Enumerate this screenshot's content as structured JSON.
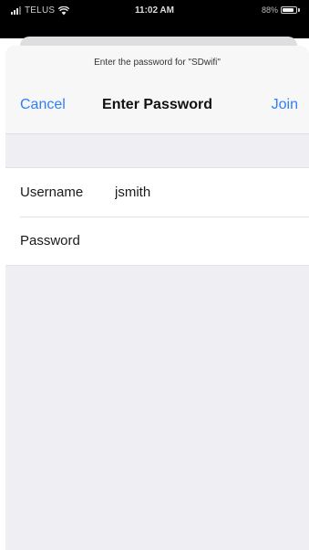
{
  "status_bar": {
    "carrier": "TELUS",
    "time": "11:02 AM",
    "battery_text": "88%",
    "battery_level": 0.88,
    "signal_icon": "cellular-signal-icon",
    "wifi_icon": "wifi-icon",
    "battery_icon": "battery-icon"
  },
  "dialog": {
    "prompt": "Enter the password for \"SDwifi\"",
    "title": "Enter Password",
    "cancel_label": "Cancel",
    "join_label": "Join"
  },
  "form": {
    "username_label": "Username",
    "username_value": "jsmith",
    "password_label": "Password",
    "password_value": ""
  },
  "colors": {
    "accent": "#2d7ff9",
    "sheet_background": "#efeff3",
    "status_bar": "#000000"
  }
}
